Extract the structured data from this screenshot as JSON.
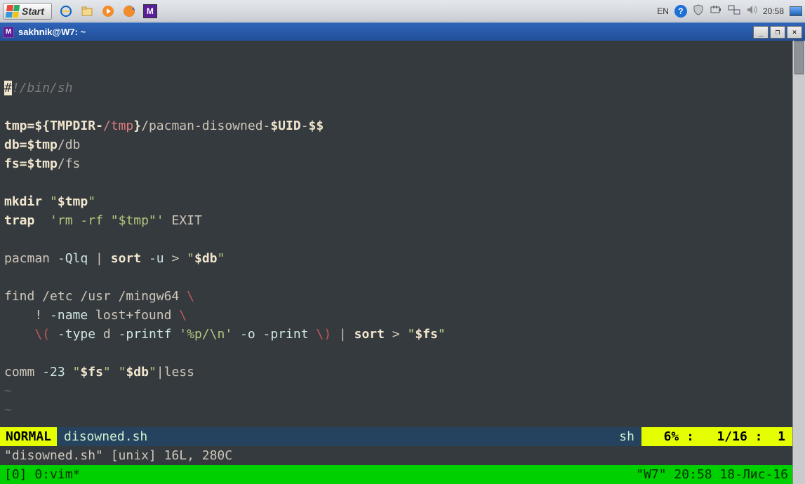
{
  "taskbar": {
    "start_label": "Start",
    "lang": "EN",
    "clock": "20:58"
  },
  "window": {
    "title": "sakhnik@W7: ~"
  },
  "code": {
    "l1_a": "#",
    "l1_b": "!/bin/sh",
    "l3_a": "tmp=${",
    "l3_b": "TMPDIR",
    "l3_c": "-",
    "l3_d": "/tmp",
    "l3_e": "}",
    "l3_f": "/pacman-disowned-",
    "l3_g": "$UID",
    "l3_h": "-",
    "l3_i": "$$",
    "l4_a": "db=$tmp",
    "l4_b": "/db",
    "l5_a": "fs=$tmp",
    "l5_b": "/fs",
    "l7_a": "mkdir ",
    "l7_b": "\"",
    "l7_c": "$tmp",
    "l7_d": "\"",
    "l8_a": "trap",
    "l8_b": "  ",
    "l8_c": "'rm -rf \"$tmp\"'",
    "l8_d": " EXIT",
    "l10_a": "pacman ",
    "l10_b": "-Qlq",
    "l10_c": " | ",
    "l10_d": "sort",
    "l10_e": " ",
    "l10_f": "-u",
    "l10_g": " > ",
    "l10_h": "\"",
    "l10_i": "$db",
    "l10_j": "\"",
    "l12_a": "find /etc /usr /mingw64 ",
    "l12_b": "\\",
    "l13_a": "    ! ",
    "l13_b": "-name",
    "l13_c": " lost+found ",
    "l13_d": "\\",
    "l14_a": "    ",
    "l14_b": "\\(",
    "l14_c": " ",
    "l14_d": "-type",
    "l14_e": " d ",
    "l14_f": "-printf",
    "l14_g": " ",
    "l14_h": "'%p/\\n'",
    "l14_i": " ",
    "l14_j": "-o",
    "l14_k": " ",
    "l14_l": "-print",
    "l14_m": " ",
    "l14_n": "\\)",
    "l14_o": " | ",
    "l14_p": "sort",
    "l14_q": " > ",
    "l14_r": "\"",
    "l14_s": "$fs",
    "l14_t": "\"",
    "l16_a": "comm ",
    "l16_b": "-23",
    "l16_c": " ",
    "l16_d": "\"",
    "l16_e": "$fs",
    "l16_f": "\"",
    "l16_g": " ",
    "l16_h": "\"",
    "l16_i": "$db",
    "l16_j": "\"",
    "l16_k": "|less",
    "tilde": "~"
  },
  "status": {
    "mode": "NORMAL",
    "filename": "disowned.sh",
    "filetype": "sh",
    "pos": "  6% :   1/16 :  1"
  },
  "msgline": "\"disowned.sh\" [unix] 16L, 280C",
  "tmux": {
    "left": "[0] 0:vim*",
    "right": "\"W7\" 20:58 18-Лис-16"
  }
}
